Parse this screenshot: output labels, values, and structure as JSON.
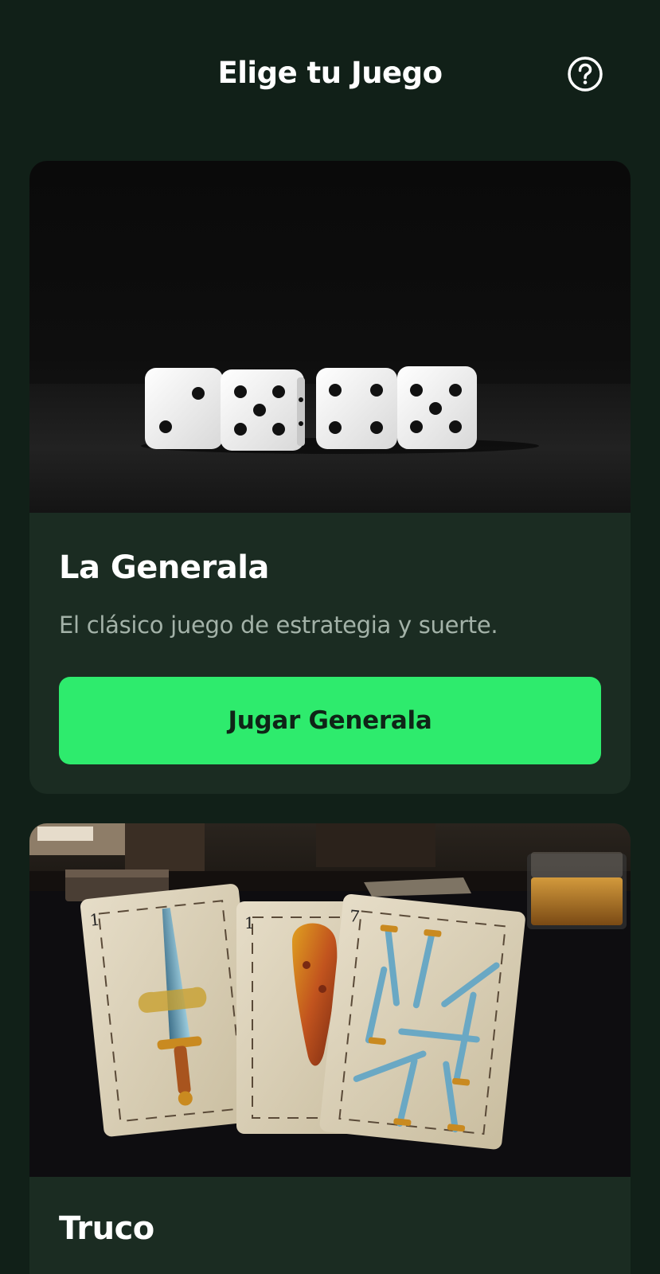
{
  "header": {
    "title": "Elige tu Juego",
    "help_icon": "question-circle-icon"
  },
  "games": [
    {
      "title": "La Generala",
      "description": "El clásico juego de estrategia y suerte.",
      "button_label": "Jugar Generala",
      "image": "dice-photo"
    },
    {
      "title": "Truco",
      "image": "spanish-cards-photo"
    }
  ],
  "colors": {
    "background": "#112018",
    "card": "#1b2c22",
    "accent": "#2eeb6d",
    "text_primary": "#ffffff",
    "text_secondary": "#a3b2a8"
  }
}
